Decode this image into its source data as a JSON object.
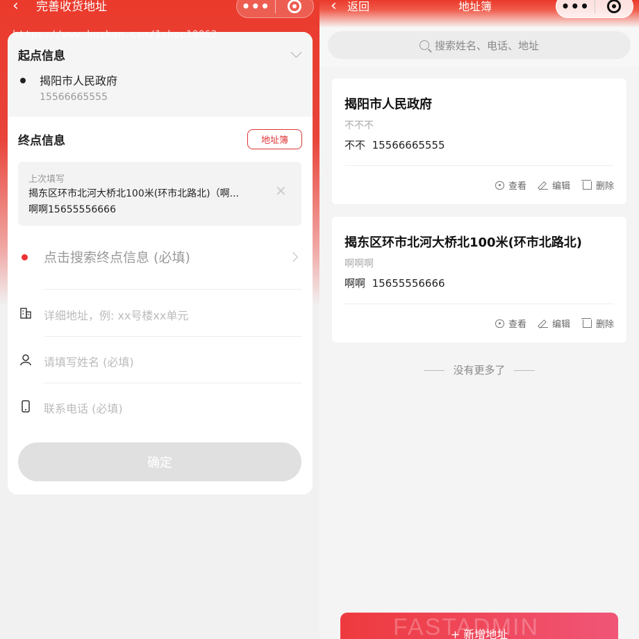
{
  "left": {
    "nav": {
      "back_icon": "chevron-left-icon",
      "title": "完善收货地址"
    },
    "watermark": "https://www.huzhan.com/1shop18862",
    "origin": {
      "section_title": "起点信息",
      "name": "揭阳市人民政府",
      "phone": "15566665555"
    },
    "destination": {
      "section_title": "终点信息",
      "address_book_label": "地址簿",
      "last_fill": {
        "label": "上次填写",
        "address": "揭东区环市北河大桥北100米(环市北路北)（啊...",
        "contact": "啊啊15655556666"
      },
      "search_placeholder": "点击搜索终点信息 (必填)",
      "detail_placeholder": "详细地址，例: xx号楼xx单元",
      "name_placeholder": "请填写姓名 (必填)",
      "phone_placeholder": "联系电话 (必填)"
    },
    "confirm_label": "确定"
  },
  "right": {
    "nav": {
      "back_label": "返回",
      "title": "地址簿"
    },
    "search_placeholder": "搜索姓名、电话、地址",
    "addresses": [
      {
        "name": "揭阳市人民政府",
        "detail": "不不不",
        "contact_name": "不不",
        "phone": "15566665555"
      },
      {
        "name": "揭东区环市北河大桥北100米(环市北路北)",
        "detail": "啊啊啊",
        "contact_name": "啊啊",
        "phone": "15655556666"
      }
    ],
    "actions": {
      "view": "查看",
      "edit": "编辑",
      "delete": "删除"
    },
    "no_more": "没有更多了",
    "add_label": "+ 新增地址",
    "add_watermark": "FASTADMIN"
  },
  "colors": {
    "brand_red": "#ea3a2c",
    "accent_pink": "#f05577"
  }
}
